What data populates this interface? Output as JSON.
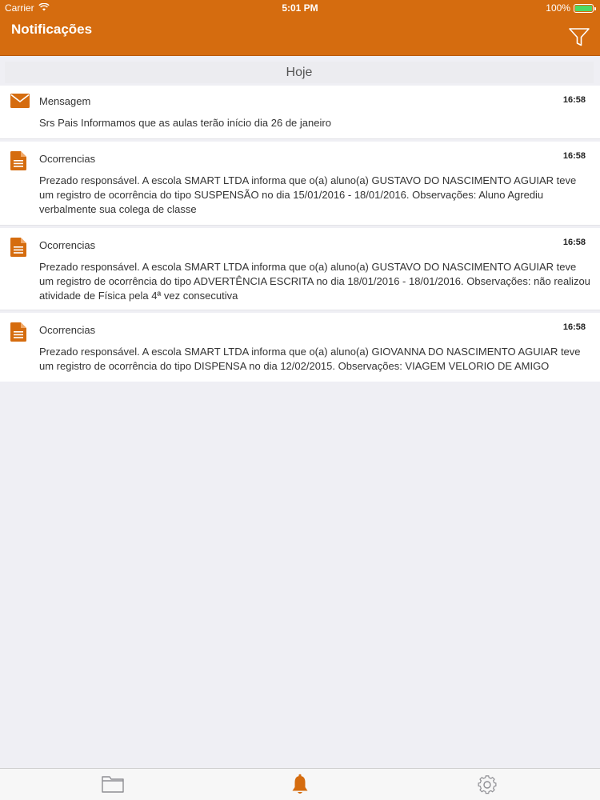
{
  "status_bar": {
    "carrier": "Carrier",
    "time": "5:01 PM",
    "battery": "100%"
  },
  "nav": {
    "title": "Notificações",
    "filter_icon": "filter-icon"
  },
  "section": {
    "title": "Hoje"
  },
  "notifications": [
    {
      "icon": "mail-icon",
      "category": "Mensagem",
      "time": "16:58",
      "body": "Srs Pais Informamos que as aulas terão início dia 26 de janeiro"
    },
    {
      "icon": "document-icon",
      "category": "Ocorrencias",
      "time": "16:58",
      "body": "Prezado responsável. A escola SMART LTDA informa que o(a) aluno(a) GUSTAVO DO NASCIMENTO AGUIAR teve um registro de ocorrência do tipo SUSPENSÃO no dia 15/01/2016 - 18/01/2016. Observações: Aluno Agrediu verbalmente sua colega de classe"
    },
    {
      "icon": "document-icon",
      "category": "Ocorrencias",
      "time": "16:58",
      "body": "Prezado responsável. A escola SMART LTDA informa que o(a) aluno(a) GUSTAVO DO NASCIMENTO AGUIAR teve um registro de ocorrência do tipo ADVERTÊNCIA ESCRITA no dia 18/01/2016 - 18/01/2016. Observações: não realizou atividade de Física pela 4ª vez consecutiva"
    },
    {
      "icon": "document-icon",
      "category": "Ocorrencias",
      "time": "16:58",
      "body": "Prezado responsável. A escola SMART LTDA informa que o(a) aluno(a) GIOVANNA DO NASCIMENTO AGUIAR teve um registro de ocorrência do tipo DISPENSA no dia 12/02/2015. Observações: VIAGEM VELORIO DE AMIGO"
    }
  ],
  "tab_bar": {
    "tabs": [
      {
        "icon": "folder-icon",
        "active": false
      },
      {
        "icon": "bell-icon",
        "active": true
      },
      {
        "icon": "gear-icon",
        "active": false
      }
    ]
  },
  "colors": {
    "accent": "#d56c0f",
    "icon": "#d56c0f",
    "inactive_tab": "#8e8e93"
  }
}
